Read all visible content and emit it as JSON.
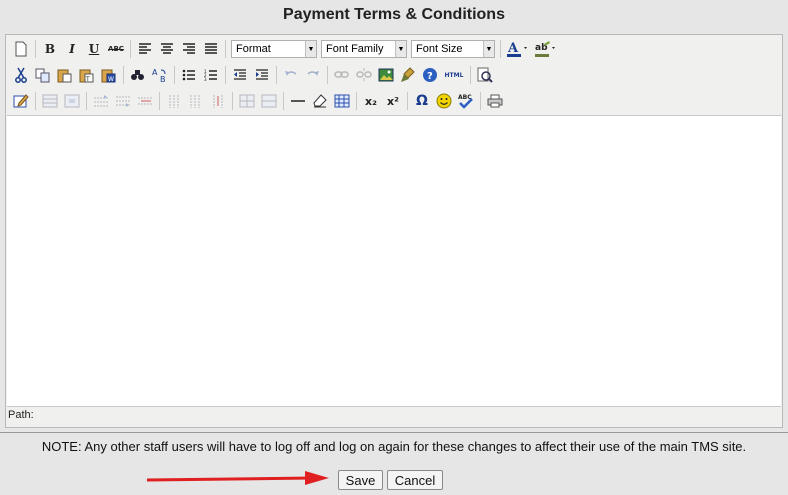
{
  "title": "Payment Terms & Conditions",
  "toolbar": {
    "format_label": "Format",
    "font_family_label": "Font Family",
    "font_size_label": "Font Size",
    "bold": "B",
    "italic": "I",
    "underline": "U",
    "strike": "ABC",
    "html": "HTML",
    "subscript": "x₂",
    "superscript": "x²",
    "omega": "Ω",
    "spell": "ABC"
  },
  "path_label": "Path:",
  "note": "NOTE: Any other staff users will have to log off and log on again for these changes to affect their use of the main TMS site.",
  "save_label": "Save",
  "cancel_label": "Cancel",
  "colors": {
    "annotation_arrow": "#e02020",
    "background": "#e6e6e6"
  }
}
